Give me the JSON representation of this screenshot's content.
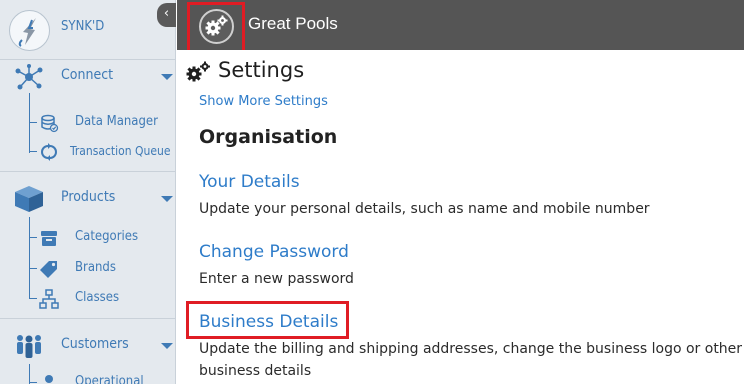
{
  "sidebar": {
    "brand_name": "SYNK'D",
    "collapse_glyph": "‹",
    "sections": {
      "connect": {
        "label": "Connect",
        "icon": "network-icon",
        "items": [
          {
            "label": "Data Manager",
            "icon": "database-icon"
          },
          {
            "label": "Transaction Queue",
            "icon": "sync-icon"
          }
        ]
      },
      "products": {
        "label": "Products",
        "icon": "box-icon",
        "items": [
          {
            "label": "Categories",
            "icon": "archive-icon"
          },
          {
            "label": "Brands",
            "icon": "tag-icon"
          },
          {
            "label": "Classes",
            "icon": "sitemap-icon"
          }
        ]
      },
      "customers": {
        "label": "Customers",
        "icon": "users-icon",
        "items": [
          {
            "label": "Operational",
            "icon": "user-icon"
          }
        ]
      }
    }
  },
  "topbar": {
    "org_name": "Great Pools",
    "settings_icon": "gears-icon"
  },
  "main": {
    "page_title": "Settings",
    "show_more": "Show More Settings",
    "group_title": "Organisation",
    "entries": [
      {
        "title": "Your Details",
        "description": "Update your personal details, such as name and mobile number"
      },
      {
        "title": "Change Password",
        "description": "Enter a new password"
      },
      {
        "title": "Business Details",
        "description": "Update the billing and shipping addresses, change the business logo or other business details"
      }
    ]
  },
  "colors": {
    "accent": "#3f7ab5",
    "link": "#2e7cc9",
    "highlight": "#e01c24",
    "topbar": "#555555",
    "sidebar": "#e4e9ee"
  }
}
